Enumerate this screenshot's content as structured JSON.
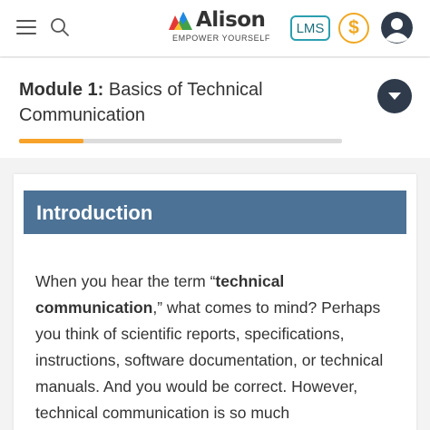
{
  "header": {
    "brand_name": "Alison",
    "brand_tagline": "EMPOWER YOURSELF",
    "lms_label": "LMS",
    "coin_symbol": "$",
    "icons": [
      "menu-icon",
      "search-icon",
      "alison-logo",
      "dollar-coin-icon",
      "user-avatar-icon"
    ]
  },
  "module": {
    "title_prefix": "Module 1:",
    "title_text": " Basics of Technical Communication",
    "progress_percent": 20,
    "dropdown_icon": "chevron-down-icon"
  },
  "content": {
    "heading": "Introduction",
    "p_before": "When you hear the term “",
    "p_bold": "technical communication",
    "p_after": ",” what comes to mind? Perhaps you think of scientific reports, specifications, instructions, software documentation, or technical manuals. And you would be correct. However, technical communication is so much"
  },
  "colors": {
    "accent_teal": "#2b9fb0",
    "coin_orange": "#f0a823",
    "progress_orange": "#f7a22a",
    "header_blue": "#4c7296",
    "dark_button": "#2f3b4b"
  }
}
